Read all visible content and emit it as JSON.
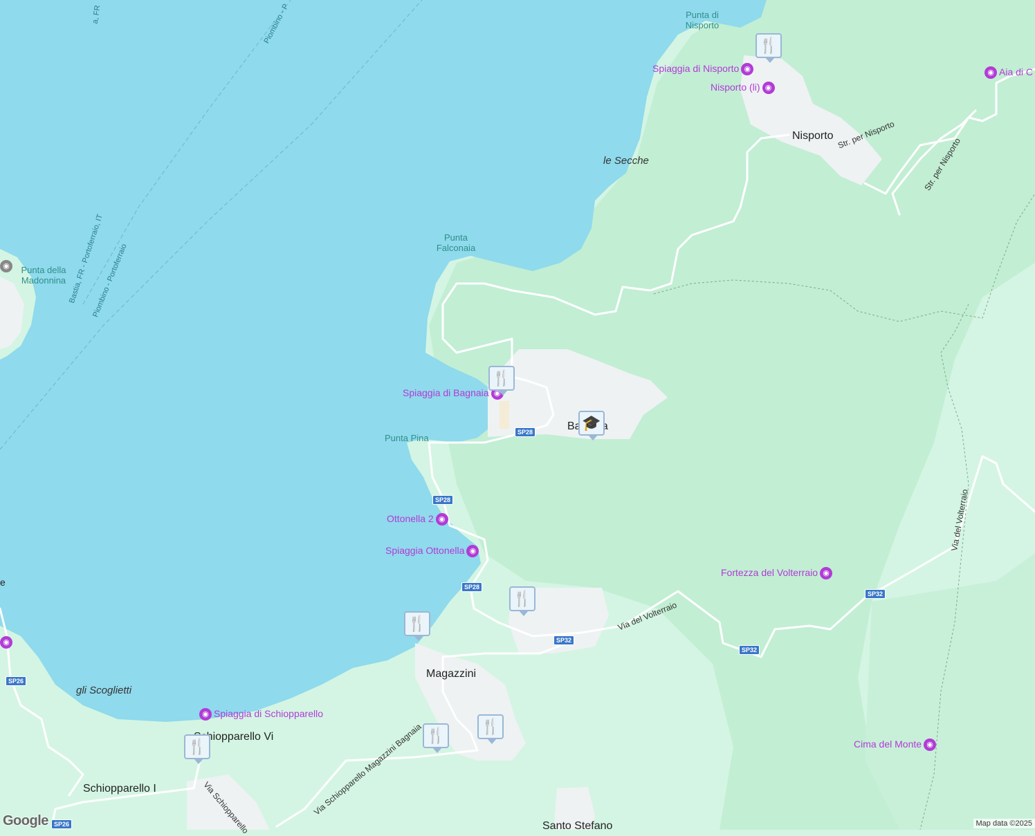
{
  "colors": {
    "sea": "#8fdaec",
    "land_light": "#d4f5e3",
    "forest": "#c2eed4",
    "urban": "#eef2f3",
    "road": "#ffffff",
    "poi": "#b23bd6",
    "shield": "#3a77c8",
    "marker_icon": "#0e4a6e"
  },
  "places": [
    {
      "id": "nisporto",
      "name": "Nisporto"
    },
    {
      "id": "bagnaia",
      "name": "Bagnaia"
    },
    {
      "id": "magazzini",
      "name": "Magazzini"
    },
    {
      "id": "schiopparello-vi",
      "name": "Schiopparello Vi"
    },
    {
      "id": "schiopparello-i",
      "name": "Schiopparello I"
    },
    {
      "id": "santo-stefano",
      "name": "Santo Stefano"
    }
  ],
  "water_labels": {
    "punta_nisporto": "Punta di Nisporto",
    "punta_falconaia": "Punta Falconaia",
    "punta_madonnina": "Punta della Madonnina",
    "punta_pina": "Punta Pina",
    "le_secche": "le Secche",
    "gli_scoglietti": "gli Scoglietti"
  },
  "pois": [
    {
      "id": "spiaggia-nisporto",
      "name": "Spiaggia di Nisporto",
      "icon": "camera-icon"
    },
    {
      "id": "nisporto-li",
      "name": "Nisporto (li)",
      "icon": "camera-icon"
    },
    {
      "id": "aia-di-c",
      "name": "Aia di C",
      "icon": "camera-icon"
    },
    {
      "id": "spiaggia-bagnaia",
      "name": "Spiaggia di Bagnaia",
      "icon": "camera-icon"
    },
    {
      "id": "ottonella-2",
      "name": "Ottonella 2",
      "icon": "camera-icon"
    },
    {
      "id": "spiaggia-ottonella",
      "name": "Spiaggia Ottonella",
      "icon": "camera-icon"
    },
    {
      "id": "fortezza-volterraio",
      "name": "Fortezza del Volterraio",
      "icon": "camera-icon"
    },
    {
      "id": "spiaggia-schiopparello",
      "name": "Spiaggia di Schiopparello",
      "icon": "camera-icon"
    },
    {
      "id": "cima-del-monte",
      "name": "Cima del Monte",
      "icon": "camera-icon"
    }
  ],
  "roads": {
    "str_nisporto_1": "Str. per Nisporto",
    "str_nisporto_2": "Str. per Nisporto",
    "via_volterraio_1": "Via del Volterraio",
    "via_volterraio_2": "Via del Volterraio",
    "via_schiopparello": "Via Schiopparello",
    "via_schiopparello_magazzini": "Via Schiopparello Magazzini Bagnaia"
  },
  "ferries": {
    "piombino_top": "Piombino - P",
    "bastia_top": "a, FR",
    "bastia_portoferraio": "Bastia, FR - Portoferraio, IT",
    "piombino_portoferraio": "Piombino - Portoferraio"
  },
  "shields": [
    "SP28",
    "SP28",
    "SP28",
    "SP32",
    "SP32",
    "SP32",
    "SP26",
    "SP26"
  ],
  "markers": [
    {
      "id": "restaurant-nisporto",
      "icon": "fork-knife-icon",
      "symbol": "🍴"
    },
    {
      "id": "restaurant-bagnaia",
      "icon": "fork-knife-icon",
      "symbol": "🍴"
    },
    {
      "id": "school-bagnaia",
      "icon": "graduation-cap-icon",
      "symbol": "🎓"
    },
    {
      "id": "restaurant-magazzini-east",
      "icon": "fork-knife-icon",
      "symbol": "🍴"
    },
    {
      "id": "restaurant-magazzini-shore",
      "icon": "fork-knife-icon",
      "symbol": "🍴"
    },
    {
      "id": "restaurant-magazzini-south-1",
      "icon": "fork-knife-icon",
      "symbol": "🍴"
    },
    {
      "id": "restaurant-magazzini-south-2",
      "icon": "fork-knife-icon",
      "symbol": "🍴"
    },
    {
      "id": "restaurant-schiopparello",
      "icon": "fork-knife-icon",
      "symbol": "🍴"
    }
  ],
  "edge_fragment": "e",
  "logo": "Google",
  "attribution": "Map data ©2025"
}
